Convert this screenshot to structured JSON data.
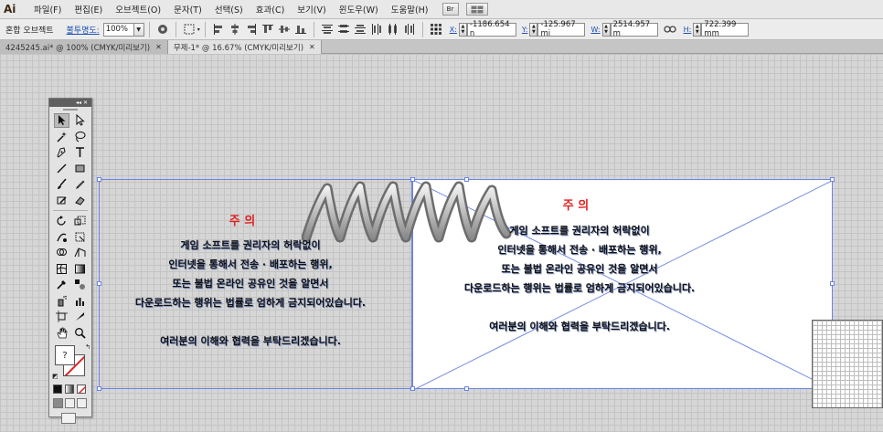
{
  "app": {
    "logo": "Ai"
  },
  "menubar": {
    "items": [
      "파일(F)",
      "편집(E)",
      "오브젝트(O)",
      "문자(T)",
      "선택(S)",
      "효과(C)",
      "보기(V)",
      "윈도우(W)",
      "도움말(H)"
    ],
    "bridge_label": "Br"
  },
  "controlbar": {
    "selection_label": "혼합 오브젝트",
    "opacity_label": "불투명도:",
    "opacity_value": "100%",
    "x_label": "X:",
    "x_value": "-1186.654 n",
    "y_label": "Y:",
    "y_value": "-125.967 mi",
    "w_label": "W:",
    "w_value": "2514.957 m",
    "h_label": "H:",
    "h_value": "722.399 mm"
  },
  "tabs": [
    {
      "label": "4245245.ai* @ 100% (CMYK/미리보기)",
      "active": false
    },
    {
      "label": "무제-1* @ 16.67% (CMYK/미리보기)",
      "active": true
    }
  ],
  "toolpanel": {
    "head_label": "◂◂ ✕",
    "fill_mark": "?"
  },
  "notice_left": {
    "title": "주 의",
    "lines": [
      "게임 소프트를 권리자의 허락없이",
      "인터넷을 통해서 전송 · 배포하는 행위,",
      "또는 불법 온라인 공유인 것을 알면서",
      "다운로드하는 행위는 법률로 엄하게 금지되어있습니다.",
      "",
      "여러분의 이해와 협력을 부탁드리겠습니다."
    ]
  },
  "notice_right": {
    "title": "주 의",
    "lines": [
      "게임 소프트를 권리자의 허락없이",
      "인터넷을 통해서 전송 · 배포하는 행위,",
      "또는 불법 온라인 공유인 것을 알면서",
      "다운로드하는 행위는 법률로 엄하게 금지되어있습니다.",
      "",
      "여러분의 이해와 협력을 부탁드리겠습니다."
    ]
  },
  "colors": {
    "accent_selection": "#6b84e6",
    "title_red": "#e01e1e"
  }
}
